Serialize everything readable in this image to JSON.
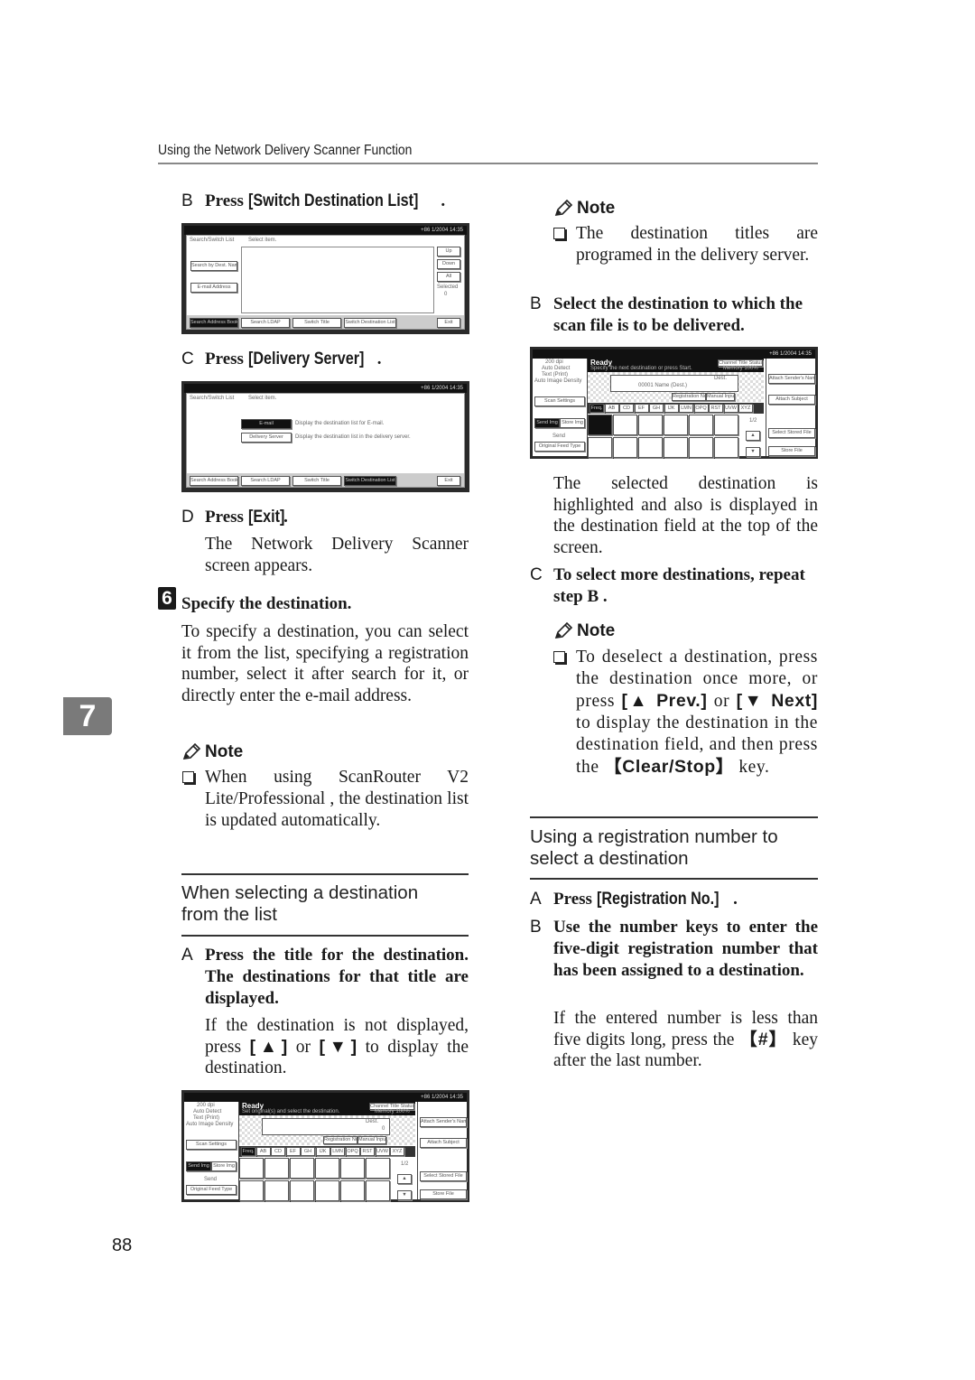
{
  "running_head": "Using the Network Delivery Scanner Function",
  "chapter_tab": "7",
  "page_number": "88",
  "left_column": {
    "step_b": {
      "letter": "B",
      "prefix": "Press ",
      "key": "[Switch Destination List]",
      "suffix": "."
    },
    "screen1": {
      "status": "+86  1/2004  14:35",
      "left_label": "Search/Switch List",
      "top_label": "Select item.",
      "left_buttons": [
        "Search by Dest. Name",
        "E-mail Address"
      ],
      "right_buttons": [
        "Up",
        "Down",
        "All"
      ],
      "selected_label": "Selected",
      "selected_count": "0",
      "tabs": [
        "Search Address Book",
        "Search LDAP",
        "Switch Title",
        "Switch Destination List"
      ],
      "exit": "Exit"
    },
    "step_c": {
      "letter": "C",
      "prefix": "Press ",
      "key": "[Delivery Server]",
      "suffix": "."
    },
    "screen2": {
      "status": "+86  1/2004  14:35",
      "left_label": "Search/Switch List",
      "top_label": "Select item.",
      "options": [
        {
          "label": "E-mail",
          "desc": "Display the destination list for E-mail.",
          "selected": true
        },
        {
          "label": "Delivery Server",
          "desc": "Display the destination list in the delivery server.",
          "selected": false
        }
      ],
      "tabs": [
        "Search Address Book",
        "Search LDAP",
        "Switch Title",
        "Switch Destination List"
      ],
      "exit": "Exit"
    },
    "step_d": {
      "letter": "D",
      "prefix": "Press ",
      "key": "[Exit]",
      "suffix": "."
    },
    "step_d_text": "The Network Delivery Scanner screen appears.",
    "step6": {
      "number": "6",
      "title": "Specify the destination."
    },
    "step6_text": "To specify a destination, you can select it from the list, specifying a registration number, select it after search for it, or directly enter the e-mail address.",
    "note1": {
      "heading": "Note",
      "item": "When using ScanRouter V2 Lite/Professional , the destination list is updated automatically."
    },
    "section1_title": "When selecting a destination from the list",
    "step_a": {
      "letter": "A",
      "text": "Press the title for the destination. The destinations for that title are displayed."
    },
    "step_a_text_parts": [
      "If the destination is not displayed, press ",
      "[▲]",
      " or ",
      "[▼]",
      " to display the destination."
    ],
    "screen3": {
      "status": "+86  1/2004  14:35",
      "ready": "Ready",
      "ready_sub": "Set original(s) and select the destination.",
      "side_info": [
        "200 dpi",
        "Auto Detect",
        "Text (Print)",
        "Auto Image Density"
      ],
      "scan_settings": "Scan Settings",
      "mode_buttons": [
        "Send Img",
        "Store Img"
      ],
      "send_label": "Send",
      "orig_type": "Original Feed Type",
      "top_right": [
        "Channel Title Status",
        "Memory 100%"
      ],
      "dest_label": "Dest.",
      "dest_count": "0",
      "reg_no": "Registration No.",
      "manual": "Manual Input",
      "title_tabs": [
        "Freq.",
        "AB",
        "CD",
        "EF",
        "GH",
        "IJK",
        "LMN",
        "OPQ",
        "RST",
        "UVW",
        "XYZ"
      ],
      "page": "1/2",
      "right_buttons": [
        "Attach Sender's Name",
        "Attach Subject",
        "Select Stored File",
        "Store File"
      ]
    }
  },
  "right_column": {
    "note2": {
      "heading": "Note",
      "item": "The destination titles are programed in the delivery server."
    },
    "step_b2": {
      "letter": "B",
      "text": "Select the destination to which the scan file is to be delivered."
    },
    "screen4": {
      "status": "+86  1/2004  14:35",
      "ready": "Ready",
      "ready_sub": "Specify the next destination or press Start.",
      "dest_selected": "00001 Name (Dest.)",
      "title_tabs": [
        "Freq.",
        "AB",
        "CD",
        "EF",
        "GH",
        "IJK",
        "LMN",
        "OPQ",
        "RST",
        "UVW",
        "XYZ"
      ],
      "page": "1/2"
    },
    "step_b2_text": "The selected destination is highlighted and also is displayed in the destination field at the top of the screen.",
    "step_c2": {
      "letter": "C",
      "text": "To select more destinations, repeat step B ."
    },
    "note3": {
      "heading": "Note",
      "parts": [
        "To deselect a destination, press the destination once more, or press ",
        "[▲ Prev.]",
        " or ",
        "[▼ Next]",
        " to display the destination in the destination field, and then press the ",
        "【Clear/Stop】",
        " key."
      ]
    },
    "section2_title": "Using a registration number to select a destination",
    "step_a3": {
      "letter": "A",
      "prefix": "Press ",
      "key": "[Registration No.]",
      "suffix": "."
    },
    "step_b3": {
      "letter": "B",
      "text": "Use the number keys to enter the five-digit registration number that has been assigned to a destination."
    },
    "step_b3_text_parts": [
      "If the entered number is less than five digits long, press the ",
      "【#】",
      " key after the last number."
    ]
  }
}
